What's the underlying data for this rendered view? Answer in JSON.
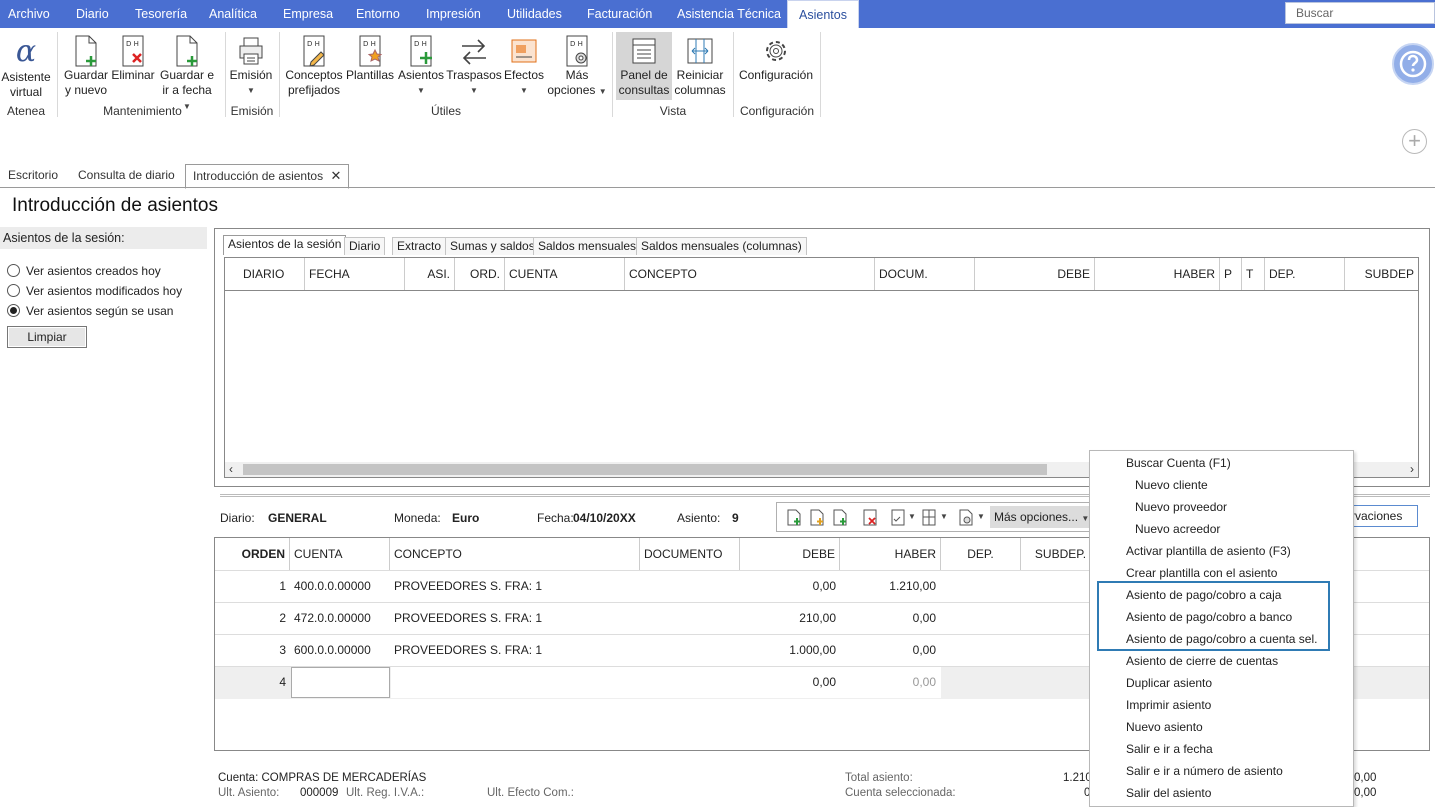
{
  "menubar": {
    "items": [
      "Archivo",
      "Diario",
      "Tesorería",
      "Analítica",
      "Empresa",
      "Entorno",
      "Impresión",
      "Utilidades",
      "Facturación",
      "Asistencia Técnica",
      "Asientos"
    ],
    "search_placeholder": "Buscar"
  },
  "ribbon": {
    "buttons": {
      "asistente": [
        "Asistente",
        "virtual"
      ],
      "guardar_nuevo": [
        "Guardar",
        "y nuevo"
      ],
      "eliminar": [
        "Eliminar"
      ],
      "guardar_fecha": [
        "Guardar e",
        "ir a fecha"
      ],
      "emision": [
        "Emisión"
      ],
      "conceptos": [
        "Conceptos",
        "prefijados"
      ],
      "plantillas": [
        "Plantillas"
      ],
      "asientos": [
        "Asientos"
      ],
      "traspasos": [
        "Traspasos"
      ],
      "efectos": [
        "Efectos"
      ],
      "mas_opciones": [
        "Más",
        "opciones"
      ],
      "panel_consultas": [
        "Panel de",
        "consultas"
      ],
      "reiniciar_columnas": [
        "Reiniciar",
        "columnas"
      ],
      "configuracion": [
        "Configuración"
      ]
    },
    "groups": [
      "Atenea",
      "Mantenimiento",
      "Emisión",
      "Útiles",
      "Vista",
      "Configuración"
    ]
  },
  "tabs": [
    "Escritorio",
    "Consulta de diario",
    "Introducción de asientos"
  ],
  "page_title": "Introducción de asientos",
  "session": {
    "label": "Asientos de la sesión:",
    "options": [
      "Ver asientos creados hoy",
      "Ver asientos modificados hoy",
      "Ver asientos según se usan"
    ],
    "selected_index": 2,
    "clear_button": "Limpiar"
  },
  "upper": {
    "subtabs": [
      "Asientos de la sesión",
      "Diario",
      "Extracto",
      "Sumas y saldos",
      "Saldos mensuales",
      "Saldos mensuales (columnas)"
    ],
    "columns": [
      "DIARIO",
      "FECHA",
      "ASI.",
      "ORD.",
      "CUENTA",
      "CONCEPTO",
      "DOCUM.",
      "DEBE",
      "HABER",
      "P",
      "T",
      "DEP.",
      "SUBDEP"
    ]
  },
  "entry_info": {
    "diario_label": "Diario:",
    "diario_value": "GENERAL",
    "moneda_label": "Moneda:",
    "moneda_value": "Euro",
    "fecha_label": "Fecha:",
    "fecha_value": "04/10/20XX",
    "asiento_label": "Asiento:",
    "asiento_value": "9",
    "mas_opciones": "Más opciones...",
    "observaciones": "rvaciones"
  },
  "lines": {
    "columns": [
      "ORDEN",
      "CUENTA",
      "CONCEPTO",
      "DOCUMENTO",
      "DEBE",
      "HABER",
      "DEP.",
      "SUBDEP."
    ],
    "rows": [
      {
        "orden": "1",
        "cuenta": "400.0.0.00000",
        "concepto": "PROVEEDORES S. FRA: 1",
        "debe": "0,00",
        "haber": "1.210,00"
      },
      {
        "orden": "2",
        "cuenta": "472.0.0.00000",
        "concepto": "PROVEEDORES S. FRA: 1",
        "debe": "210,00",
        "haber": "0,00"
      },
      {
        "orden": "3",
        "cuenta": "600.0.0.00000",
        "concepto": "PROVEEDORES S. FRA: 1",
        "debe": "1.000,00",
        "haber": "0,00"
      },
      {
        "orden": "4",
        "cuenta": "",
        "concepto": "",
        "debe": "0,00",
        "haber": "0,00"
      }
    ]
  },
  "footer": {
    "cuenta_label": "Cuenta:",
    "cuenta_value": "COMPRAS DE MERCADERÍAS",
    "ult_asiento_label": "Ult. Asiento:",
    "ult_asiento_value": "000009",
    "ult_reg_iva_label": "Ult. Reg. I.V.A.:",
    "ult_efecto_label": "Ult. Efecto Com.:",
    "total_asiento_label": "Total asiento:",
    "total_asiento_value": "1.210",
    "cuenta_sel_label": "Cuenta seleccionada:",
    "cuenta_sel_value": "0",
    "right_value_1": "0,00",
    "right_value_2": "0,00"
  },
  "context_menu": {
    "items": [
      "Buscar Cuenta (F1)",
      "Nuevo cliente",
      "Nuevo proveedor",
      "Nuevo acreedor",
      "Activar plantilla de asiento (F3)",
      "Crear plantilla con el asiento",
      "Asiento de pago/cobro a caja",
      "Asiento de pago/cobro a banco",
      "Asiento de pago/cobro a cuenta sel.",
      "Asiento de cierre de cuentas",
      "Duplicar asiento",
      "Imprimir asiento",
      "Nuevo asiento",
      "Salir e ir a fecha",
      "Salir e ir a número de asiento",
      "Salir del asiento"
    ],
    "highlight_color": "#2f7bb4"
  },
  "colors": {
    "menubar": "#4a6fd1",
    "accent": "#2f7bb4"
  }
}
